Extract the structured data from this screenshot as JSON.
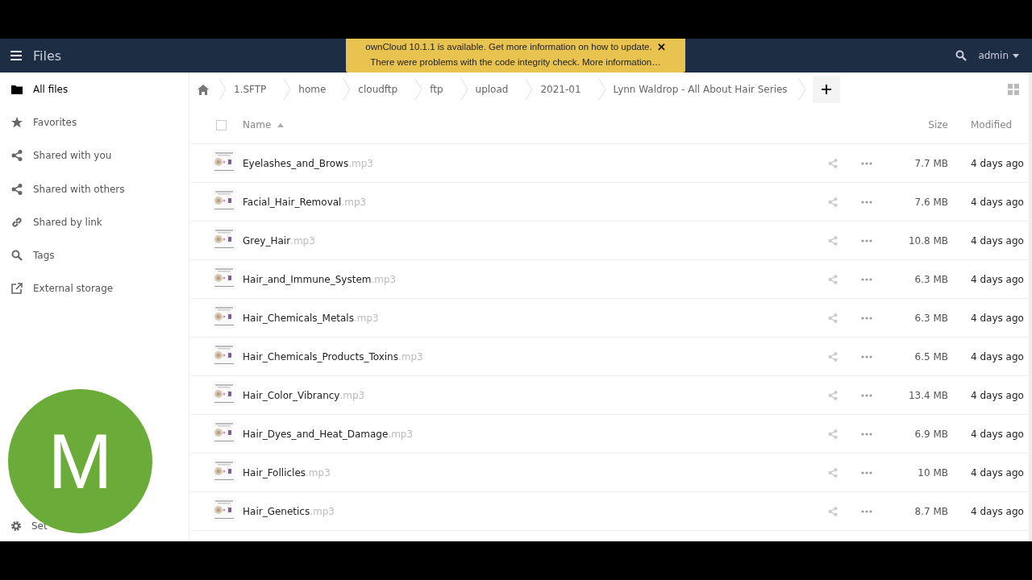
{
  "header": {
    "app_title": "Files",
    "user": "admin"
  },
  "notification": {
    "lines": [
      "ownCloud 10.1.1 is available. Get more information on how to update.",
      "There were problems with the code integrity check. More information…"
    ],
    "close": "✕"
  },
  "sidebar": {
    "items": [
      {
        "label": "All files",
        "selected": true
      },
      {
        "label": "Favorites",
        "selected": false
      },
      {
        "label": "Shared with you",
        "selected": false
      },
      {
        "label": "Shared with others",
        "selected": false
      },
      {
        "label": "Shared by link",
        "selected": false
      },
      {
        "label": "Tags",
        "selected": false
      },
      {
        "label": "External storage",
        "selected": false
      }
    ],
    "settings": "Set"
  },
  "breadcrumb": [
    "1.SFTP",
    "home",
    "cloudftp",
    "ftp",
    "upload",
    "2021-01",
    "Lynn Waldrop - All About Hair Series"
  ],
  "table": {
    "select_all": {
      "checked": false
    },
    "columns": [
      "Name",
      "Size",
      "Modified"
    ],
    "rows": [
      {
        "name": "Eyelashes_and_Brows",
        "ext": ".mp3",
        "size": "7.7 MB",
        "modified": "4 days ago"
      },
      {
        "name": "Facial_Hair_Removal",
        "ext": ".mp3",
        "size": "7.6 MB",
        "modified": "4 days ago"
      },
      {
        "name": "Grey_Hair",
        "ext": ".mp3",
        "size": "10.8 MB",
        "modified": "4 days ago"
      },
      {
        "name": "Hair_and_Immune_System",
        "ext": ".mp3",
        "size": "6.3 MB",
        "modified": "4 days ago"
      },
      {
        "name": "Hair_Chemicals_Metals",
        "ext": ".mp3",
        "size": "6.3 MB",
        "modified": "4 days ago"
      },
      {
        "name": "Hair_Chemicals_Products_Toxins",
        "ext": ".mp3",
        "size": "6.5 MB",
        "modified": "4 days ago"
      },
      {
        "name": "Hair_Color_Vibrancy",
        "ext": ".mp3",
        "size": "13.4 MB",
        "modified": "4 days ago"
      },
      {
        "name": "Hair_Dyes_and_Heat_Damage",
        "ext": ".mp3",
        "size": "6.9 MB",
        "modified": "4 days ago"
      },
      {
        "name": "Hair_Follicles",
        "ext": ".mp3",
        "size": "10 MB",
        "modified": "4 days ago"
      },
      {
        "name": "Hair_Genetics",
        "ext": ".mp3",
        "size": "8.7 MB",
        "modified": "4 days ago"
      }
    ]
  },
  "avatar": {
    "letter": "M",
    "color": "#6aab3a"
  }
}
